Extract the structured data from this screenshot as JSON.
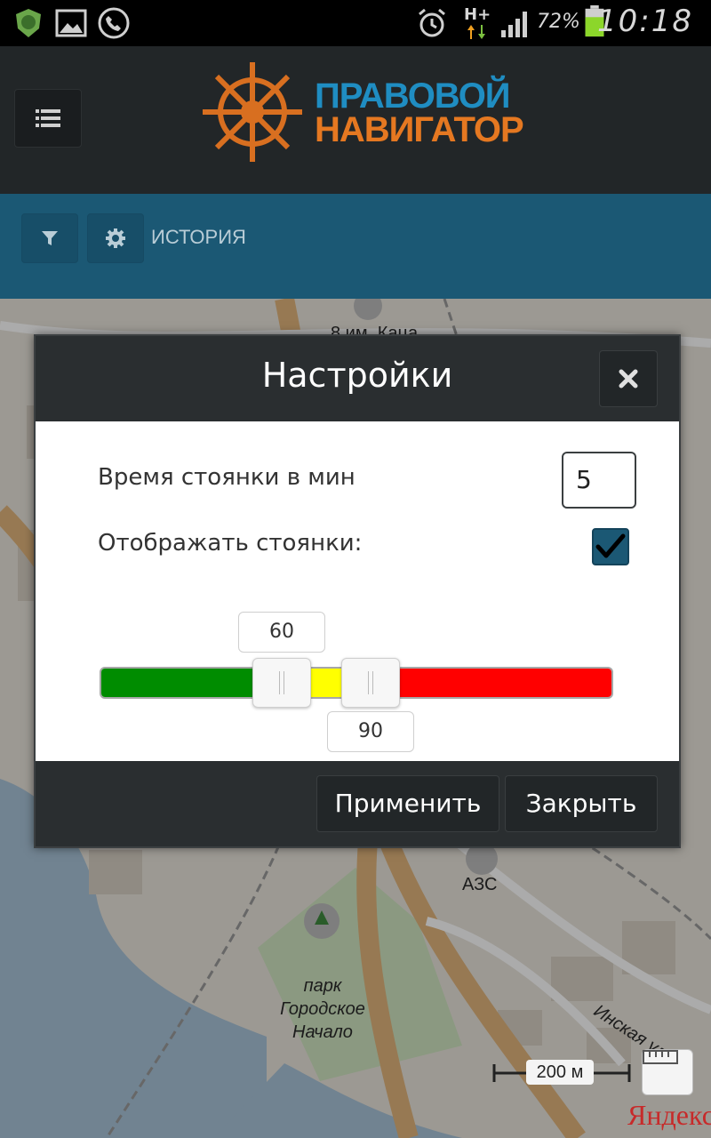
{
  "status_bar": {
    "battery_percent": "72%",
    "network": "H+",
    "time": "10:18"
  },
  "app": {
    "logo_line1": "ПРАВОВОЙ",
    "logo_line2": "НАВИГАТОР",
    "toolbar_label": "ИСТОРИЯ"
  },
  "map": {
    "labels": {
      "poi_top": "8 им. Каца",
      "gas_station": "АЗС",
      "park": "парк\nГородское\nНачало",
      "street": "Инская ул."
    },
    "scale": "200 м",
    "brand": "Яндекс"
  },
  "dialog": {
    "title": "Настройки",
    "parking_time_label": "Время стоянки в мин",
    "parking_time_value": "5",
    "show_parking_label": "Отображать стоянки:",
    "show_parking_checked": true,
    "range": {
      "low": "60",
      "high": "90",
      "colors": {
        "low": "#008c00",
        "mid": "#ffff00",
        "high": "#ff0000"
      }
    },
    "apply_label": "Применить",
    "close_label": "Закрыть"
  }
}
